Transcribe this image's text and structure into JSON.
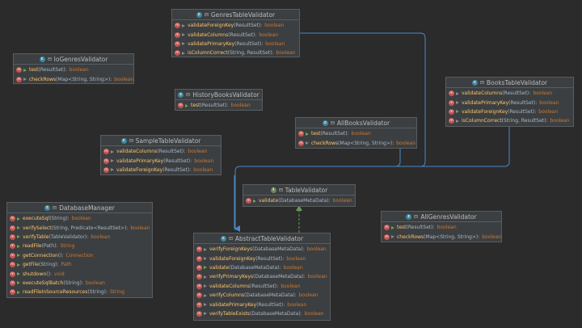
{
  "classes": {
    "genres_table_validator": {
      "name": "GenresTableValidator",
      "methods": [
        {
          "name": "validateForeignKey",
          "params": "(ResultSet):",
          "type": "boolean"
        },
        {
          "name": "validateColumns",
          "params": "(ResultSet):",
          "type": "boolean"
        },
        {
          "name": "validatePrimaryKey",
          "params": "(ResultSet):",
          "type": "boolean"
        },
        {
          "name": "isColumnCorrect",
          "params": "(String, ResultSet):",
          "type": "boolean"
        }
      ]
    },
    "io_genres_validator": {
      "name": "IoGenresValidator",
      "methods": [
        {
          "name": "test",
          "params": "(ResultSet):",
          "type": "boolean"
        },
        {
          "name": "checkRows",
          "params": "(Map<String, String>):",
          "type": "boolean"
        }
      ]
    },
    "history_books_validator": {
      "name": "HistoryBooksValidator",
      "methods": [
        {
          "name": "test",
          "params": "(ResultSet):",
          "type": "boolean"
        }
      ]
    },
    "books_table_validator": {
      "name": "BooksTableValidator",
      "methods": [
        {
          "name": "validateColumns",
          "params": "(ResultSet):",
          "type": "boolean"
        },
        {
          "name": "validatePrimaryKey",
          "params": "(ResultSet):",
          "type": "boolean"
        },
        {
          "name": "validateForeignKey",
          "params": "(ResultSet):",
          "type": "boolean"
        },
        {
          "name": "isColumnCorrect",
          "params": "(String, ResultSet):",
          "type": "boolean"
        }
      ]
    },
    "all_books_validator": {
      "name": "AllBooksValidator",
      "methods": [
        {
          "name": "test",
          "params": "(ResultSet):",
          "type": "boolean"
        },
        {
          "name": "checkRows",
          "params": "(Map<String, String>):",
          "type": "boolean"
        }
      ]
    },
    "sample_table_validator": {
      "name": "SampleTableValidator",
      "methods": [
        {
          "name": "validateColumns",
          "params": "(ResultSet):",
          "type": "boolean"
        },
        {
          "name": "validatePrimaryKey",
          "params": "(ResultSet):",
          "type": "boolean"
        },
        {
          "name": "validateForeignKey",
          "params": "(ResultSet):",
          "type": "boolean"
        }
      ]
    },
    "table_validator": {
      "name": "TableValidator",
      "methods": [
        {
          "name": "validate",
          "params": "(DatabaseMetaData):",
          "type": "boolean"
        }
      ]
    },
    "database_manager": {
      "name": "DatabaseManager",
      "methods": [
        {
          "name": "executeSql",
          "params": "(String):",
          "type": "boolean"
        },
        {
          "name": "verifySelect",
          "params": "(String, Predicate<ResultSet>):",
          "type": "boolean"
        },
        {
          "name": "verifyTable",
          "params": "(TableValidator):",
          "type": "boolean"
        },
        {
          "name": "readFile",
          "params": "(Path):",
          "type": "String"
        },
        {
          "name": "getConnection",
          "params": "():",
          "type": "Connection"
        },
        {
          "name": "getFile",
          "params": "(String):",
          "type": "Path"
        },
        {
          "name": "shutdown",
          "params": "():",
          "type": "void"
        },
        {
          "name": "executeSqlBatch",
          "params": "(String):",
          "type": "boolean"
        },
        {
          "name": "readFileInSourceResources",
          "params": "(String):",
          "type": "String"
        }
      ]
    },
    "abstract_table_validator": {
      "name": "AbstractTableValidator",
      "methods": [
        {
          "name": "verifyForeignKeys",
          "params": "(DatabaseMetaData):",
          "type": "boolean"
        },
        {
          "name": "validateForeignKey",
          "params": "(ResultSet):",
          "type": "boolean"
        },
        {
          "name": "validate",
          "params": "(DatabaseMetaData):",
          "type": "boolean"
        },
        {
          "name": "verifyPrimaryKeys",
          "params": "(DatabaseMetaData):",
          "type": "boolean"
        },
        {
          "name": "validateColumns",
          "params": "(ResultSet):",
          "type": "boolean"
        },
        {
          "name": "verifyColumns",
          "params": "(DatabaseMetaData):",
          "type": "boolean"
        },
        {
          "name": "validatePrimaryKey",
          "params": "(ResultSet):",
          "type": "boolean"
        },
        {
          "name": "verifyTableExists",
          "params": "(DatabaseMetaData):",
          "type": "boolean"
        }
      ]
    },
    "all_genres_validator": {
      "name": "AllGenresValidator",
      "methods": [
        {
          "name": "test",
          "params": "(ResultSet):",
          "type": "boolean"
        },
        {
          "name": "checkRows",
          "params": "(Map<String, String>):",
          "type": "boolean"
        }
      ]
    }
  },
  "icons": {
    "class_glyph": "c",
    "interface_glyph": "I",
    "method_glyph": "m"
  },
  "colors": {
    "background": "#2b2b2b",
    "box": "#3c3f41",
    "method_name": "#ffc66d",
    "return_type": "#cc7832",
    "extends_edge": "#4a88c7",
    "implements_edge": "#6a9955"
  }
}
